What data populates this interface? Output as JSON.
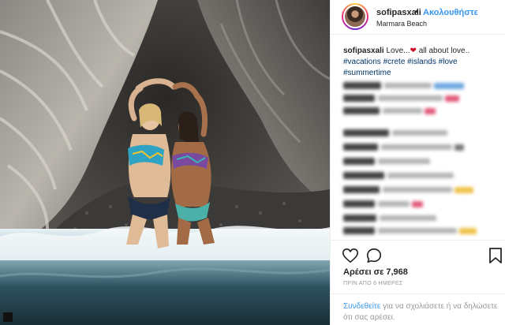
{
  "header": {
    "username": "sofipasxali",
    "separator": "•",
    "follow_label": "Ακολουθήστε",
    "location": "Marmara Beach"
  },
  "caption": {
    "username": "sofipasxali",
    "text_before": "Love...",
    "heart": "❤",
    "text_after": "all about love..",
    "hashtags": [
      "#vacations",
      "#crete",
      "#islands",
      "#love",
      "#summertime"
    ]
  },
  "stats": {
    "likes_label": "Αρέσει σε 7,968",
    "timestamp": "ΠΡΙΝ ΑΠΟ 6 ΗΜΕΡΕΣ"
  },
  "footer": {
    "login_link": "Συνδεθείτε",
    "login_text": "για να σχολιάσετε ή να δηλώσετε ότι σας αρέσει."
  },
  "icons": {
    "like": "heart-outline-icon",
    "comment": "speech-bubble-icon",
    "save": "bookmark-icon"
  },
  "colors": {
    "link_blue": "#3897f0",
    "hashtag_blue": "#003569",
    "heart_red": "#c8102e",
    "muted_gray": "#999999"
  }
}
